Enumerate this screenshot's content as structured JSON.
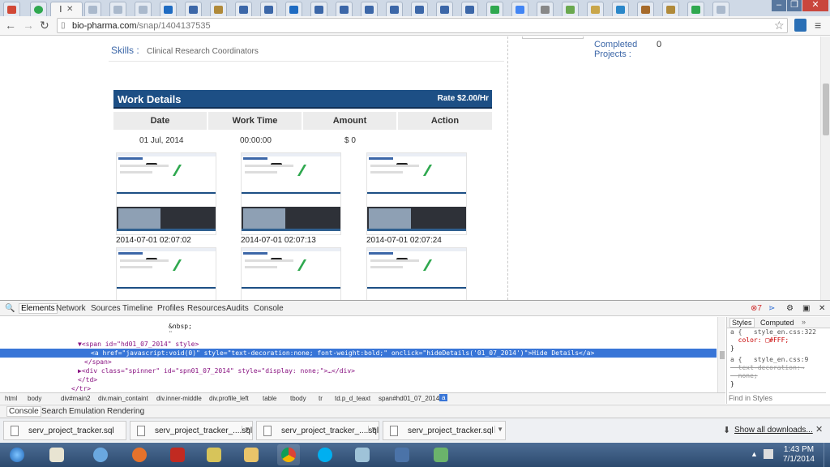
{
  "browser": {
    "active_tab_label": "l",
    "tab_count": 37,
    "url_host": "bio-pharma.com",
    "url_path": "/snap/1404137535"
  },
  "profile": {
    "skills_label": "Skills :",
    "skills_value": "Clinical Research Coordinators",
    "completed_projects_label": "Completed Projects :",
    "completed_projects_value": "0"
  },
  "work_details": {
    "title": "Work Details",
    "rate": "Rate $2.00/Hr",
    "columns": [
      "Date",
      "Work Time",
      "Amount",
      "Action"
    ],
    "row": {
      "date": "01 Jul, 2014",
      "work_time": "00:00:00",
      "amount": "$ 0"
    },
    "snapshots": [
      "2014-07-01 02:07:02",
      "2014-07-01 02:07:13",
      "2014-07-01 02:07:24"
    ]
  },
  "devtools": {
    "tabs": [
      "Elements",
      "Network",
      "Sources",
      "Timeline",
      "Profiles",
      "Resources",
      "Audits",
      "Console"
    ],
    "active_tab": "Elements",
    "error_count": "7",
    "dom_lines": [
      "&nbsp;",
      "\"",
      "▼<span id=\"hd01_07_2014\" style>",
      "<a href=\"javascript:void(0)\" style=\"text-decoration:none; font-weight:bold;\" onclick=\"hideDetails('01_07_2014')\">Hide Details</a>",
      "</span>",
      "▶<div class=\"spinner\" id=\"spn01_07_2014\" style=\"display: none;\">…</div>",
      "</td>",
      "</tr>"
    ],
    "breadcrumbs": [
      "html",
      "body",
      "div#main2",
      "div.main_containt",
      "div.inner-middle",
      "div.profile_left",
      "table",
      "tbody",
      "tr",
      "td.p_d_teaxt",
      "span#hd01_07_2014",
      "a"
    ],
    "styles_tabs": [
      "Styles",
      "Computed"
    ],
    "styles_lines": [
      "a {   style_en.css:322",
      "  color: □#FFF;",
      "}",
      "a {   style_en.css:9",
      "  text-decoration:→",
      "  none;",
      "}"
    ],
    "find_placeholder": "Find in Styles",
    "drawer_tabs": [
      "Console",
      "Search",
      "Emulation",
      "Rendering"
    ]
  },
  "downloads": {
    "items": [
      "serv_project_tracker.sql",
      "serv_project_tracker_....sql",
      "serv_project_tracker_....sql",
      "serv_project_tracker.sql"
    ],
    "show_all": "Show all downloads..."
  },
  "taskbar": {
    "time": "1:43 PM",
    "date": "7/1/2014"
  },
  "colors": {
    "header_blue": "#1d4f85",
    "link_blue": "#3c67a8",
    "selection_blue": "#3875d7"
  }
}
